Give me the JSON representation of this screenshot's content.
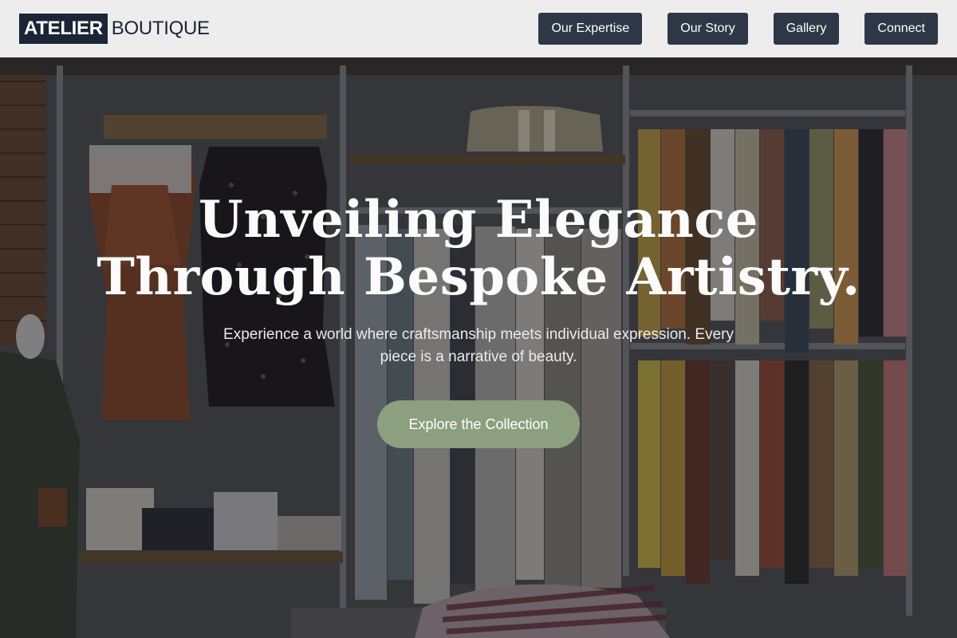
{
  "brand": {
    "name_primary": "ATELIER",
    "name_secondary": "BOUTIQUE"
  },
  "nav": {
    "items": [
      {
        "label": "Our Expertise"
      },
      {
        "label": "Our Story"
      },
      {
        "label": "Gallery"
      },
      {
        "label": "Connect"
      }
    ]
  },
  "hero": {
    "title": "Unveiling Elegance Through Bespoke Artistry.",
    "subtitle": "Experience a world where craftsmanship meets individual expression. Every piece is a narrative of beauty.",
    "cta_label": "Explore the Collection",
    "background_image": "boutique-clothing-racks-photo"
  },
  "colors": {
    "header_bg": "#ededee",
    "logo_navy": "#1c2537",
    "nav_button_bg": "#2e3747",
    "cta_bg": "#8c9f7f"
  }
}
